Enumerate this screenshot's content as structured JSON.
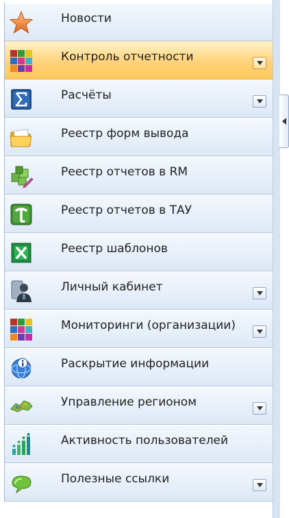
{
  "nav": {
    "items": [
      {
        "label": "Новости",
        "icon": "star-icon",
        "active": false,
        "dropdown": false
      },
      {
        "label": "Контроль отчетности",
        "icon": "colored-grid-icon",
        "active": true,
        "dropdown": true
      },
      {
        "label": "Расчёты",
        "icon": "sigma-document-icon",
        "active": false,
        "dropdown": true
      },
      {
        "label": "Реестр форм вывода",
        "icon": "folder-icon",
        "active": false,
        "dropdown": false
      },
      {
        "label": "Реестр отчетов в RM",
        "icon": "cubes-pencil-icon",
        "active": false,
        "dropdown": false
      },
      {
        "label": "Реестр отчетов в ТАУ",
        "icon": "letter-t-icon",
        "active": false,
        "dropdown": false
      },
      {
        "label": "Реестр шаблонов",
        "icon": "excel-icon",
        "active": false,
        "dropdown": false
      },
      {
        "label": "Личный кабинет",
        "icon": "user-icon",
        "active": false,
        "dropdown": true
      },
      {
        "label": "Мониторинги (организации)",
        "icon": "colored-grid-icon",
        "active": false,
        "dropdown": true
      },
      {
        "label": "Раскрытие информации",
        "icon": "info-globe-icon",
        "active": false,
        "dropdown": false
      },
      {
        "label": "Управление регионом",
        "icon": "region-map-icon",
        "active": false,
        "dropdown": true
      },
      {
        "label": "Активность пользователей",
        "icon": "bar-dots-icon",
        "active": false,
        "dropdown": false
      },
      {
        "label": "Полезные ссылки",
        "icon": "speech-bubble-icon",
        "active": false,
        "dropdown": true
      }
    ]
  },
  "splitter": {
    "icon": "chevron-left-icon"
  }
}
